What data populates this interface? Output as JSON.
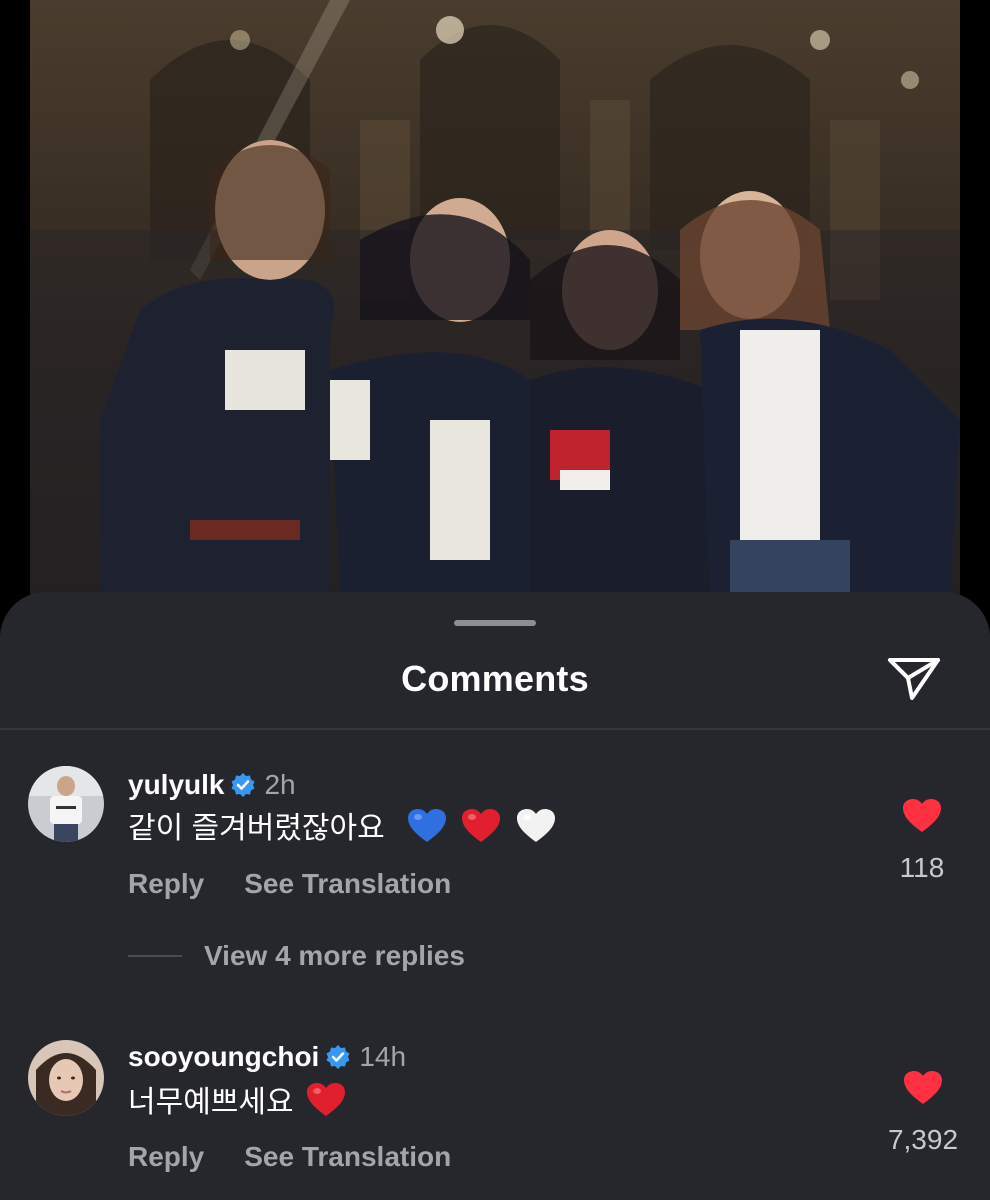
{
  "sheet": {
    "title": "Comments",
    "share_icon": "paper-plane-icon"
  },
  "comments": [
    {
      "username": "yulyulk",
      "verified": true,
      "time": "2h",
      "text": "같이 즐겨버렸잖아요",
      "emojis": [
        "blue-heart",
        "red-heart",
        "white-heart"
      ],
      "reply_label": "Reply",
      "translate_label": "See Translation",
      "likes": "118",
      "view_replies": "View 4 more replies"
    },
    {
      "username": "sooyoungchoi",
      "verified": true,
      "time": "14h",
      "text": "너무예쁘세요",
      "emojis": [
        "red-heart"
      ],
      "reply_label": "Reply",
      "translate_label": "See Translation",
      "likes": "7,392"
    }
  ],
  "colors": {
    "sheet_bg": "#25272c",
    "like_red": "#ff3040",
    "verified_blue": "#3897f0",
    "muted_text": "#a3a5aa"
  }
}
